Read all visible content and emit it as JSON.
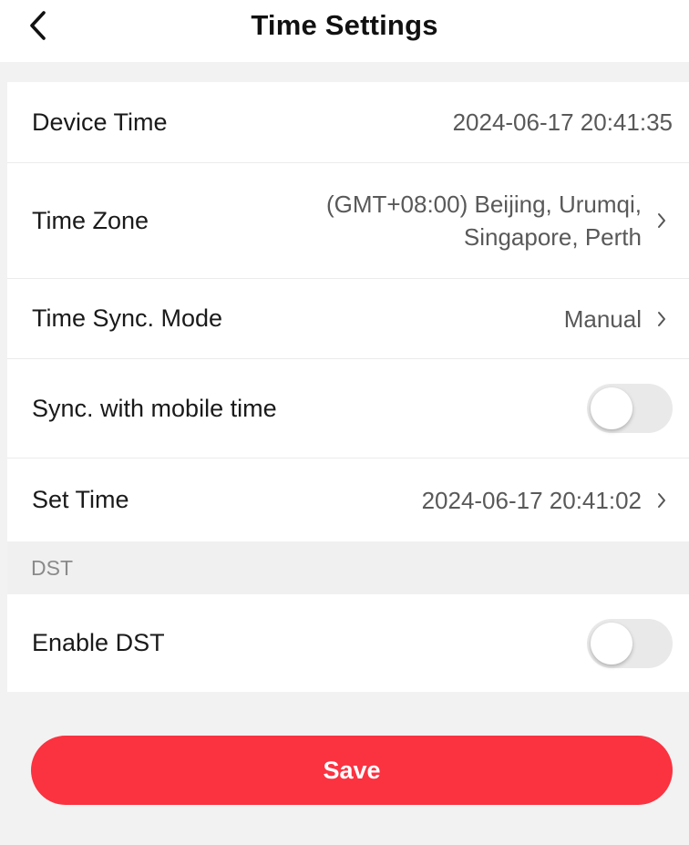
{
  "header": {
    "title": "Time Settings",
    "back_icon": "chevron-left-icon"
  },
  "settings": {
    "device_time": {
      "label": "Device Time",
      "value": "2024-06-17 20:41:35"
    },
    "time_zone": {
      "label": "Time Zone",
      "value_line1": "(GMT+08:00) Beijing, Urumqi,",
      "value_line2": "Singapore, Perth"
    },
    "time_sync_mode": {
      "label": "Time Sync. Mode",
      "value": "Manual"
    },
    "sync_mobile": {
      "label": "Sync. with mobile time",
      "enabled": false
    },
    "set_time": {
      "label": "Set Time",
      "value": "2024-06-17 20:41:02"
    }
  },
  "dst": {
    "section_label": "DST",
    "enable_label": "Enable DST",
    "enabled": false
  },
  "footer": {
    "save_label": "Save"
  },
  "colors": {
    "accent": "#fb3240",
    "toggle_off": "#e9e9e9",
    "background": "#f2f2f2"
  }
}
